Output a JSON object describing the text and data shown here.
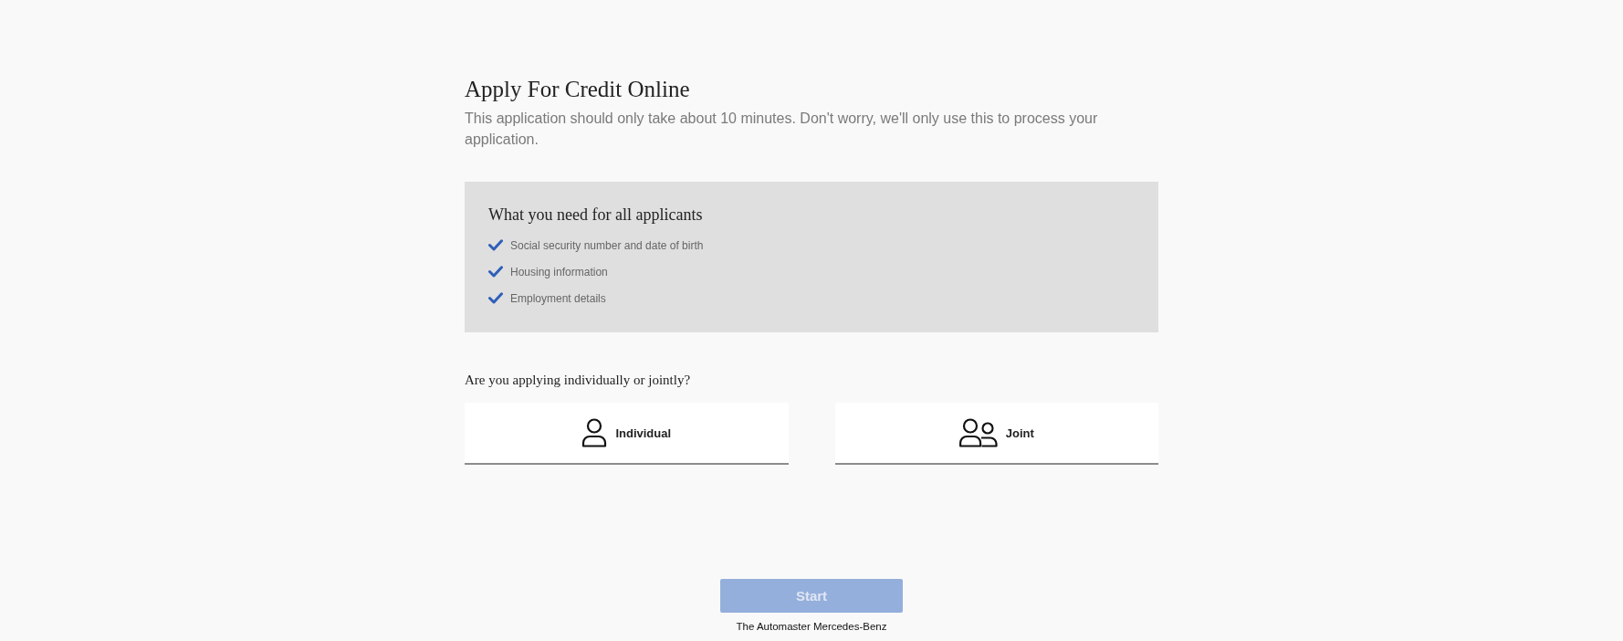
{
  "page": {
    "title": "Apply For Credit Online",
    "subtitle": "This application should only take about 10 minutes. Don't worry, we'll only use this to process your application."
  },
  "requirements": {
    "heading": "What you need for all applicants",
    "items": [
      "Social security number and date of birth",
      "Housing information",
      "Employment details"
    ]
  },
  "question": {
    "label": "Are you applying individually or jointly?",
    "options": [
      {
        "kind": "individual",
        "label": "Individual",
        "selected": false
      },
      {
        "kind": "joint",
        "label": "Joint",
        "selected": false
      }
    ]
  },
  "start_button": {
    "label": "Start",
    "disabled": true
  },
  "footer": {
    "text": "The Automaster Mercedes-Benz"
  }
}
